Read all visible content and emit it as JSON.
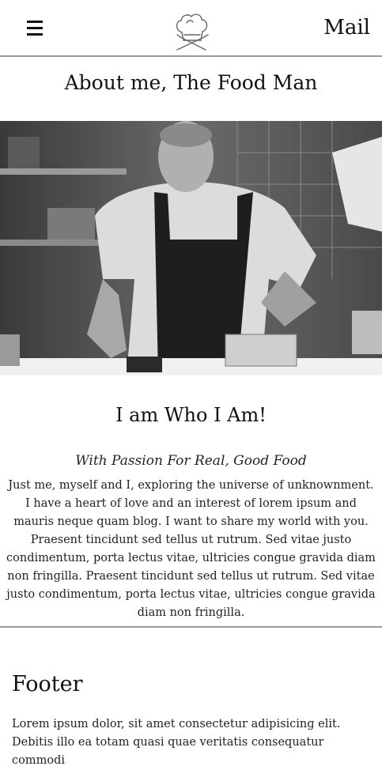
{
  "header": {
    "mail_label": "Mail",
    "menu_icon": "hamburger-icon",
    "logo_icon": "chef-hat-logo"
  },
  "page": {
    "title": "About me, The Food Man"
  },
  "hero": {
    "alt": "Chef plating food in a kitchen (black and white photo)"
  },
  "about": {
    "heading": "I am Who I Am!",
    "tagline": "With Passion For Real, Good Food",
    "bio": "Just me, myself and I, exploring the universe of unknownment. I have a heart of love and an interest of lorem ipsum and mauris neque quam blog. I want to share my world with you. Praesent tincidunt sed tellus ut rutrum. Sed vitae justo condimentum, porta lectus vitae, ultricies congue gravida diam non fringilla. Praesent tincidunt sed tellus ut rutrum. Sed vitae justo condimentum, porta lectus vitae, ultricies congue gravida diam non fringilla."
  },
  "footer": {
    "heading": "Footer",
    "text": "Lorem ipsum dolor, sit amet consectetur adipisicing elit. Debitis illo ea totam quasi quae veritatis consequatur commodi"
  }
}
